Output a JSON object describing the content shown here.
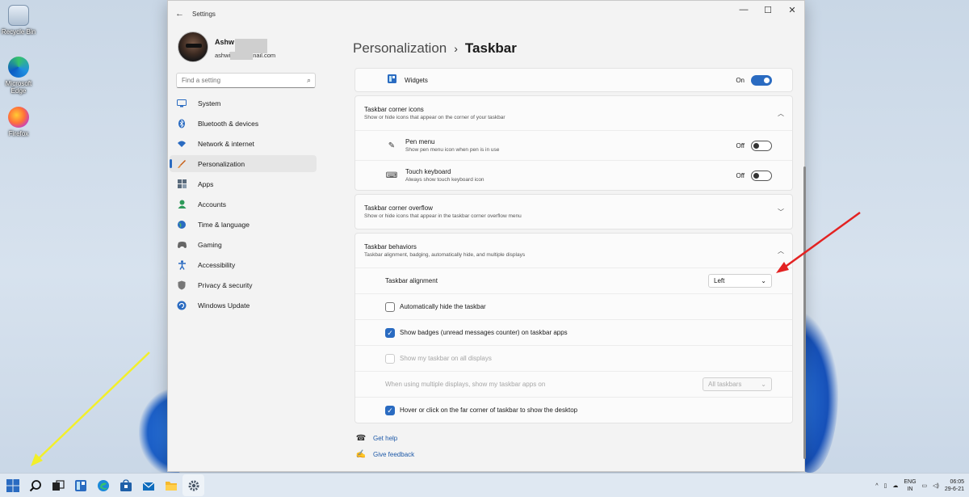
{
  "desktop": {
    "icons": [
      {
        "label": "Recycle Bin",
        "icon": "recycle-bin-icon"
      },
      {
        "label": "Microsoft Edge",
        "icon": "edge-icon"
      },
      {
        "label": "Firefox",
        "icon": "firefox-icon"
      }
    ]
  },
  "window": {
    "app_title": "Settings",
    "controls": {
      "minimize": "—",
      "maximize": "☐",
      "close": "✕"
    }
  },
  "profile": {
    "name_visible": "Ashw",
    "email_prefix": "ashwi",
    "email_suffix": "nail.com"
  },
  "search": {
    "placeholder": "Find a setting"
  },
  "nav": {
    "items": [
      {
        "label": "System",
        "icon": "system-icon",
        "color": "#2a6bc1"
      },
      {
        "label": "Bluetooth & devices",
        "icon": "bluetooth-icon",
        "color": "#2a6bc1"
      },
      {
        "label": "Network & internet",
        "icon": "wifi-icon",
        "color": "#2a6bc1"
      },
      {
        "label": "Personalization",
        "icon": "brush-icon",
        "color": "#c55a11"
      },
      {
        "label": "Apps",
        "icon": "apps-icon",
        "color": "#5a6b7c"
      },
      {
        "label": "Accounts",
        "icon": "accounts-icon",
        "color": "#2e9a5a"
      },
      {
        "label": "Time & language",
        "icon": "globe-icon",
        "color": "#2a6bc1"
      },
      {
        "label": "Gaming",
        "icon": "gaming-icon",
        "color": "#666666"
      },
      {
        "label": "Accessibility",
        "icon": "accessibility-icon",
        "color": "#2a6bc1"
      },
      {
        "label": "Privacy & security",
        "icon": "shield-icon",
        "color": "#666666"
      },
      {
        "label": "Windows Update",
        "icon": "update-icon",
        "color": "#2a6bc1"
      }
    ],
    "active_index": 3
  },
  "breadcrumb": {
    "parent": "Personalization",
    "separator": "›",
    "current": "Taskbar"
  },
  "widgets_row": {
    "label": "Widgets",
    "state": "On"
  },
  "corner_icons": {
    "title": "Taskbar corner icons",
    "desc": "Show or hide icons that appear on the corner of your taskbar",
    "items": [
      {
        "label": "Pen menu",
        "desc": "Show pen menu icon when pen is in use",
        "state": "Off"
      },
      {
        "label": "Touch keyboard",
        "desc": "Always show touch keyboard icon",
        "state": "Off"
      }
    ]
  },
  "corner_overflow": {
    "title": "Taskbar corner overflow",
    "desc": "Show or hide icons that appear in the taskbar corner overflow menu"
  },
  "behaviors": {
    "title": "Taskbar behaviors",
    "desc": "Taskbar alignment, badging, automatically hide, and multiple displays",
    "alignment_label": "Taskbar alignment",
    "alignment_value": "Left",
    "auto_hide": "Automatically hide the taskbar",
    "badges": "Show badges (unread messages counter) on taskbar apps",
    "all_displays": "Show my taskbar on all displays",
    "multi_label": "When using multiple displays, show my taskbar apps on",
    "multi_value": "All taskbars",
    "far_corner": "Hover or click on the far corner of taskbar to show the desktop"
  },
  "links": {
    "help": "Get help",
    "feedback": "Give feedback"
  },
  "tray": {
    "lang_top": "ENG",
    "lang_bottom": "IN",
    "time": "06:05",
    "date": "29-6-21",
    "chevron": "^"
  },
  "colors": {
    "accent": "#2a6bc1",
    "red_arrow": "#e32222",
    "yellow_arrow": "#f2ef2a"
  }
}
